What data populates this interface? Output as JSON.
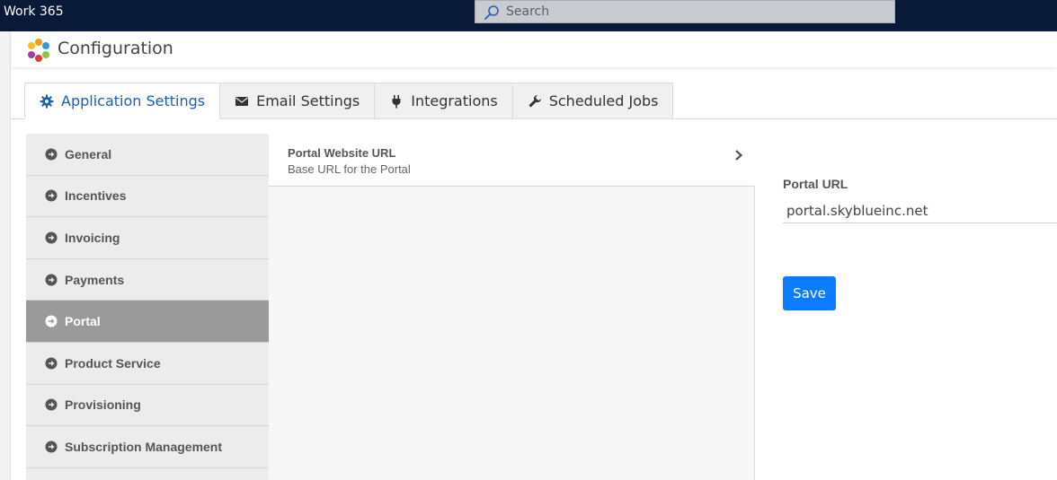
{
  "app": {
    "title": "Work 365"
  },
  "search": {
    "placeholder": "Search"
  },
  "header": {
    "title": "Configuration"
  },
  "tabs": [
    {
      "label": "Application Settings",
      "icon": "gear-icon",
      "active": true
    },
    {
      "label": "Email Settings",
      "icon": "envelope-icon",
      "active": false
    },
    {
      "label": "Integrations",
      "icon": "plug-icon",
      "active": false
    },
    {
      "label": "Scheduled Jobs",
      "icon": "wrench-icon",
      "active": false
    }
  ],
  "sidebar": {
    "items": [
      {
        "label": "General"
      },
      {
        "label": "Incentives"
      },
      {
        "label": "Invoicing"
      },
      {
        "label": "Payments"
      },
      {
        "label": "Portal",
        "active": true
      },
      {
        "label": "Product Service"
      },
      {
        "label": "Provisioning"
      },
      {
        "label": "Subscription Management"
      }
    ]
  },
  "settings_list": {
    "items": [
      {
        "title": "Portal Website URL",
        "subtitle": "Base URL for the Portal"
      }
    ]
  },
  "form": {
    "field_label": "Portal URL",
    "field_value": "portal.skyblueinc.net",
    "save_label": "Save"
  },
  "colors": {
    "topbar": "#081a38",
    "accent": "#0a7cff",
    "active_tab_text": "#1a5fb4",
    "active_nav_bg": "#9a9a9a"
  }
}
